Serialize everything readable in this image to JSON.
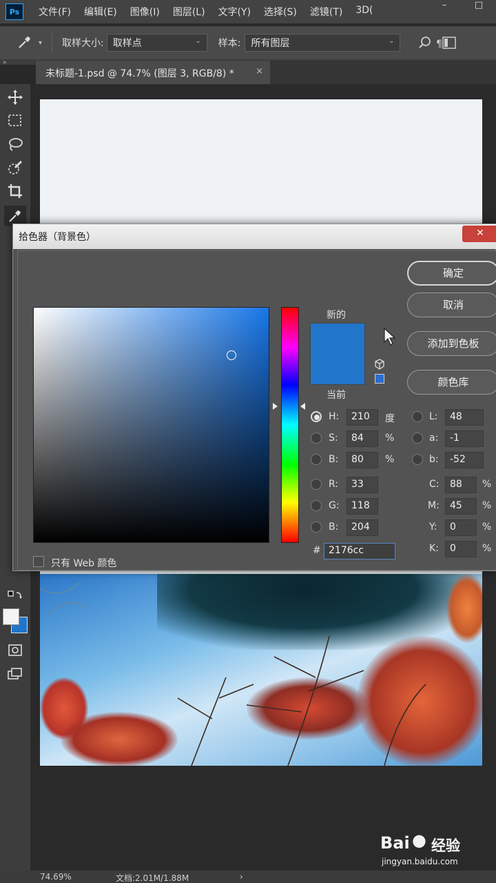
{
  "app": {
    "logo": "Ps",
    "menu": [
      "文件(F)",
      "编辑(E)",
      "图像(I)",
      "图层(L)",
      "文字(Y)",
      "选择(S)",
      "滤镜(T)",
      "3D("
    ],
    "window_buttons": [
      "–",
      "□"
    ]
  },
  "options_bar": {
    "sample_size_label": "取样大小:",
    "sample_size_value": "取样点",
    "sample_label": "样本:",
    "sample_value": "所有图层"
  },
  "document": {
    "tab_title": "未标题-1.psd @ 74.7% (图层 3, RGB/8) *",
    "tab_close": "×"
  },
  "status": {
    "zoom": "74.69%",
    "doc_size": "文档:2.01M/1.88M",
    "arrow": "›"
  },
  "color_picker": {
    "title": "拾色器（背景色）",
    "close": "✕",
    "new_label": "新的",
    "current_label": "当前",
    "new_color": "#2176cc",
    "buttons": {
      "ok": "确定",
      "cancel": "取消",
      "add_to_swatches": "添加到色板",
      "color_libraries": "颜色库"
    },
    "web_only_label": "只有 Web 颜色",
    "hsb": {
      "h": {
        "label": "H:",
        "value": "210",
        "unit": "度"
      },
      "s": {
        "label": "S:",
        "value": "84",
        "unit": "%"
      },
      "b": {
        "label": "B:",
        "value": "80",
        "unit": "%"
      }
    },
    "lab": {
      "l": {
        "label": "L:",
        "value": "48"
      },
      "a": {
        "label": "a:",
        "value": "-1"
      },
      "b": {
        "label": "b:",
        "value": "-52"
      }
    },
    "rgb": {
      "r": {
        "label": "R:",
        "value": "33"
      },
      "g": {
        "label": "G:",
        "value": "118"
      },
      "b": {
        "label": "B:",
        "value": "204"
      }
    },
    "cmyk": {
      "c": {
        "label": "C:",
        "value": "88",
        "unit": "%"
      },
      "m": {
        "label": "M:",
        "value": "45",
        "unit": "%"
      },
      "y": {
        "label": "Y:",
        "value": "0",
        "unit": "%"
      },
      "k": {
        "label": "K:",
        "value": "0",
        "unit": "%"
      }
    },
    "hex": {
      "label": "#",
      "value": "2176cc"
    },
    "selected_mode": "H"
  },
  "watermark": {
    "brand": "Bai",
    "brand2": "经验",
    "url": "jingyan.baidu.com"
  }
}
